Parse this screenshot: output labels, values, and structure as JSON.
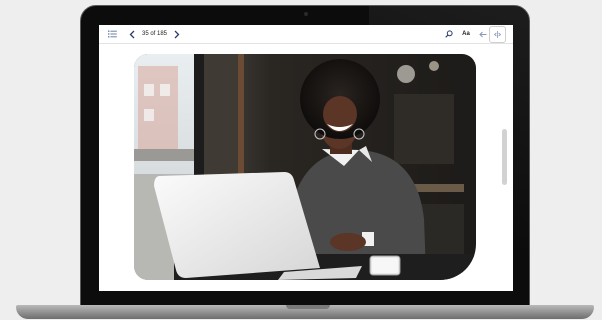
{
  "reader": {
    "page_indicator": "35 of 185",
    "font_button_label": "Aa"
  },
  "icons": {
    "toc": "list-icon",
    "prev": "chevron-left-icon",
    "next": "chevron-right-icon",
    "search": "search-icon",
    "back": "back-arrow-icon",
    "more": "more-vertical-icon",
    "fit": "fit-width-icon"
  },
  "colors": {
    "accent": "#2c3e6b",
    "page_background": "#eeeeee",
    "laptop_frame": "#0c0c0c"
  }
}
